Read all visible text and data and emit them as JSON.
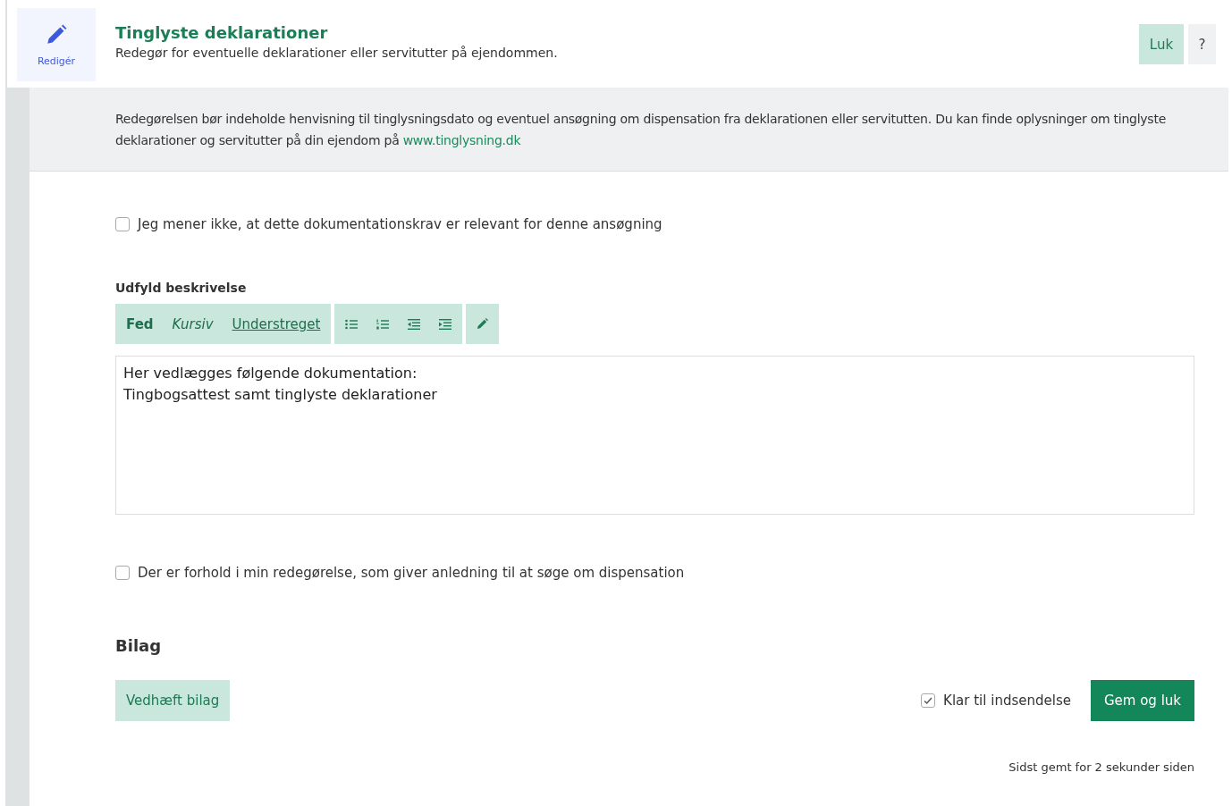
{
  "header": {
    "edit_label": "Redigér",
    "title": "Tinglyste deklarationer",
    "subtitle": "Redegør for eventuelle deklarationer eller servitutter på ejendommen.",
    "buttons": [
      {
        "label": "Luk",
        "kind": "primary"
      },
      {
        "label": "?",
        "kind": "help"
      }
    ]
  },
  "info": {
    "text": "Redegørelsen bør indeholde henvisning til tinglysningsdato og eventuel ansøgning om dispensation fra deklarationen eller servitutten. Du kan finde oplysninger om tinglyste deklarationer og servitutter på din ejendom på",
    "link": "www.tinglysning.dk"
  },
  "not_relevant": {
    "label": "Jeg mener ikke, at dette dokumentationskrav er relevant for denne ansøgning",
    "checked": false
  },
  "description": {
    "label": "Udfyld beskrivelse",
    "toolbar": [
      [
        {
          "kind": "bold",
          "label": "Fed"
        },
        {
          "kind": "italic",
          "label": "Kursiv"
        },
        {
          "kind": "underline",
          "label": "Understreget"
        }
      ],
      [
        {
          "kind": "bullet-list"
        },
        {
          "kind": "numbered-list"
        },
        {
          "kind": "outdent"
        },
        {
          "kind": "indent"
        }
      ],
      [
        {
          "kind": "pencil"
        }
      ]
    ],
    "lines": [
      "Her vedlægges følgende dokumentation:",
      "Tingbogsattest samt tinglyste deklarationer"
    ]
  },
  "dispensation": {
    "label": "Der er forhold i min redegørelse, som giver anledning til at søge om dispensation",
    "checked": false
  },
  "attachments": {
    "title": "Bilag",
    "attach_button": "Vedhæft bilag"
  },
  "ready": {
    "label": "Klar til indsendelse",
    "checked": true
  },
  "save_button": "Gem og luk",
  "saved_status": "Sidst gemt for 2 sekunder siden"
}
